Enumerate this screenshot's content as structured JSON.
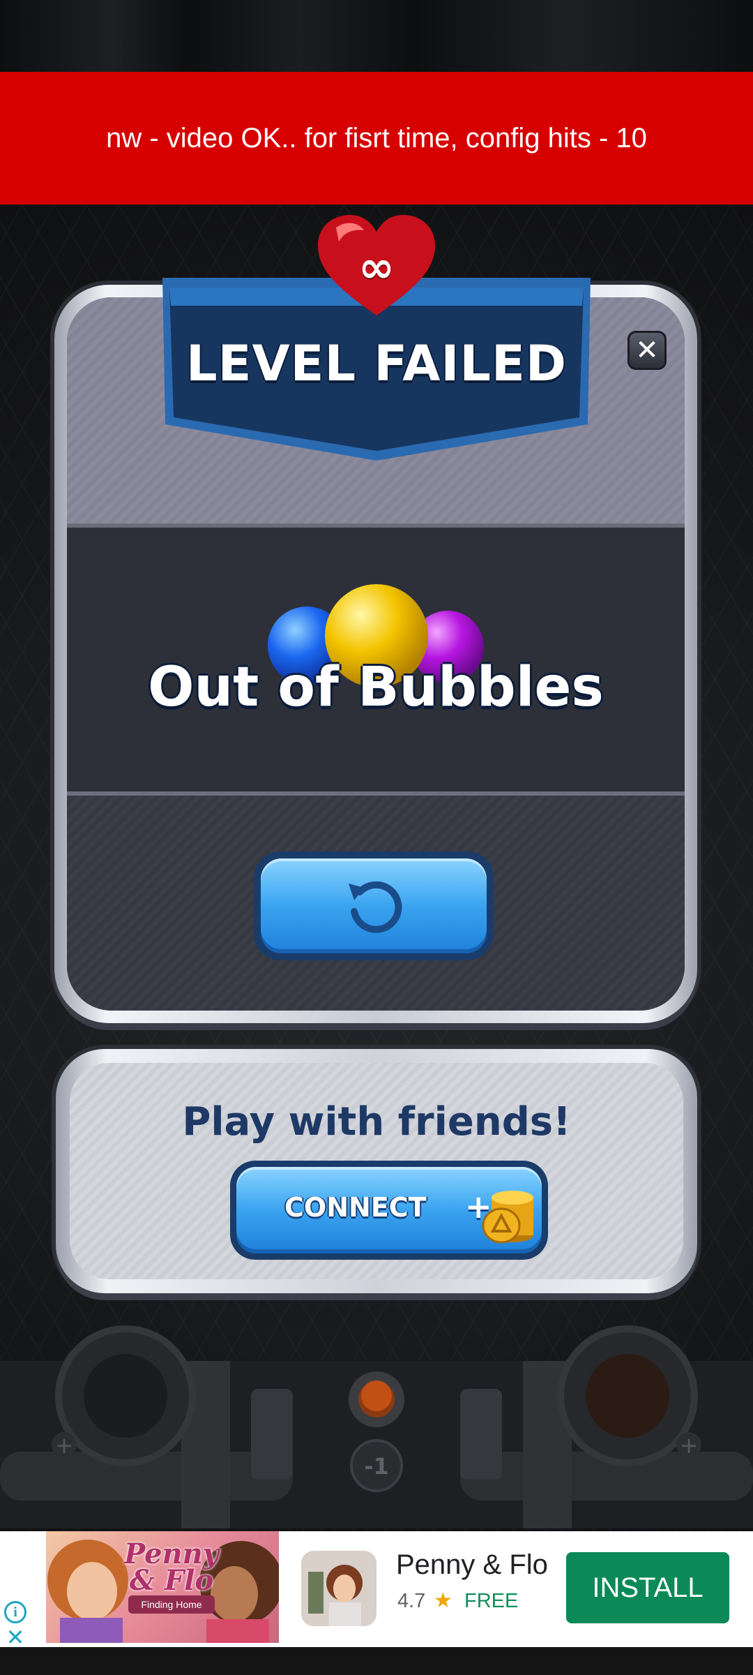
{
  "debug_banner": {
    "text": "nw - video OK.. for fisrt time, config hits - 10"
  },
  "heart": {
    "symbol": "∞"
  },
  "popup": {
    "title": "LEVEL FAILED",
    "close_symbol": "✕",
    "reason": "Out of Bubbles",
    "retry_icon": "retry-icon"
  },
  "friends": {
    "title": "Play with friends!",
    "connect_label": "CONNECT",
    "plus": "+"
  },
  "machine": {
    "counter": "-1"
  },
  "ad": {
    "banner_title": "Penny & Flo",
    "banner_subtitle": "Finding Home",
    "app_name": "Penny & Flo",
    "rating": "4.7",
    "star": "★",
    "price": "FREE",
    "install_label": "INSTALL",
    "info_symbol": "i",
    "close_symbol": "✕"
  },
  "colors": {
    "debug_red": "#d60000",
    "button_blue": "#3aa4f0",
    "install_green": "#0b8a57",
    "title_navy": "#1e3966"
  }
}
